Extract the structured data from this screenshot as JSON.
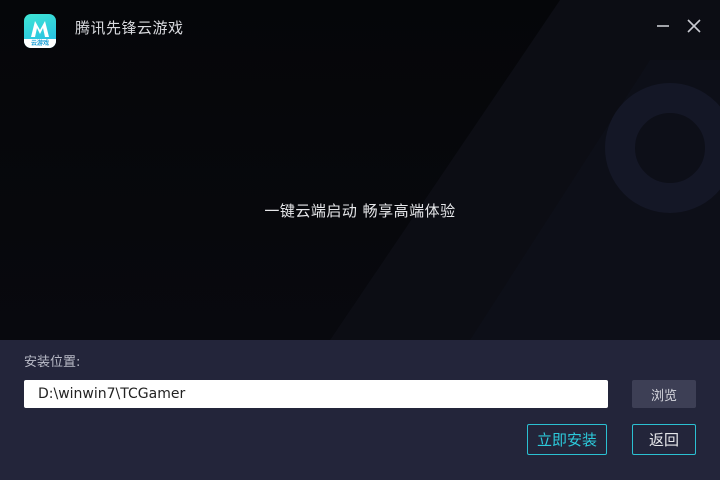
{
  "app": {
    "title": "腾讯先锋云游戏",
    "logo_icon": "tencent-start-logo-icon",
    "logo_badge": "云游戏",
    "accent_color": "#2bc0d2"
  },
  "window_controls": {
    "minimize_icon": "minimize-icon",
    "close_icon": "close-icon"
  },
  "hero": {
    "slogan": "一键云端启动 畅享高端体验"
  },
  "install": {
    "label": "安装位置:",
    "path_value": "D:\\winwin7\\TCGamer",
    "browse_label": "浏览",
    "install_label": "立即安装",
    "back_label": "返回"
  }
}
